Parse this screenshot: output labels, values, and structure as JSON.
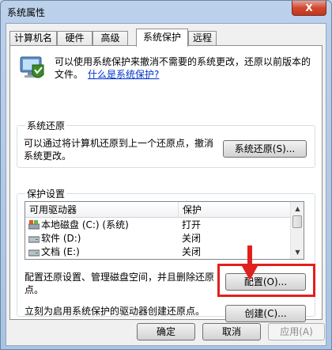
{
  "window": {
    "title": "系统属性",
    "close_symbol": "X"
  },
  "tabs": [
    {
      "label": "计算机名"
    },
    {
      "label": "硬件"
    },
    {
      "label": "高级"
    },
    {
      "label": "系统保护",
      "active": true
    },
    {
      "label": "远程"
    }
  ],
  "intro": {
    "text": "可以使用系统保护来撤消不需要的系统更改，还原以前版本的文件。",
    "link": "什么是系统保护?"
  },
  "restore_group": {
    "title": "系统还原",
    "description": "可以通过将计算机还原到上一个还原点，撤消系统更改。",
    "button": "系统还原(S)..."
  },
  "protection_group": {
    "title": "保护设置",
    "columns": [
      "可用驱动器",
      "保护"
    ],
    "drives": [
      {
        "name": "本地磁盘 (C:) (系统)",
        "protection": "打开",
        "icon": "system-drive-icon"
      },
      {
        "name": "软件 (D:)",
        "protection": "关闭",
        "icon": "drive-icon"
      },
      {
        "name": "文档 (E:)",
        "protection": "关闭",
        "icon": "drive-icon"
      }
    ],
    "configure_text": "配置还原设置、管理磁盘空间，并且删除还原点。",
    "configure_button": "配置(O)...",
    "create_text": "立刻为启用系统保护的驱动器创建还原点。",
    "create_button": "创建(C)..."
  },
  "footer": {
    "ok": "确定",
    "cancel": "取消",
    "apply": "应用(A)"
  },
  "colors": {
    "highlight": "#e1201d",
    "link": "#0033cc"
  }
}
